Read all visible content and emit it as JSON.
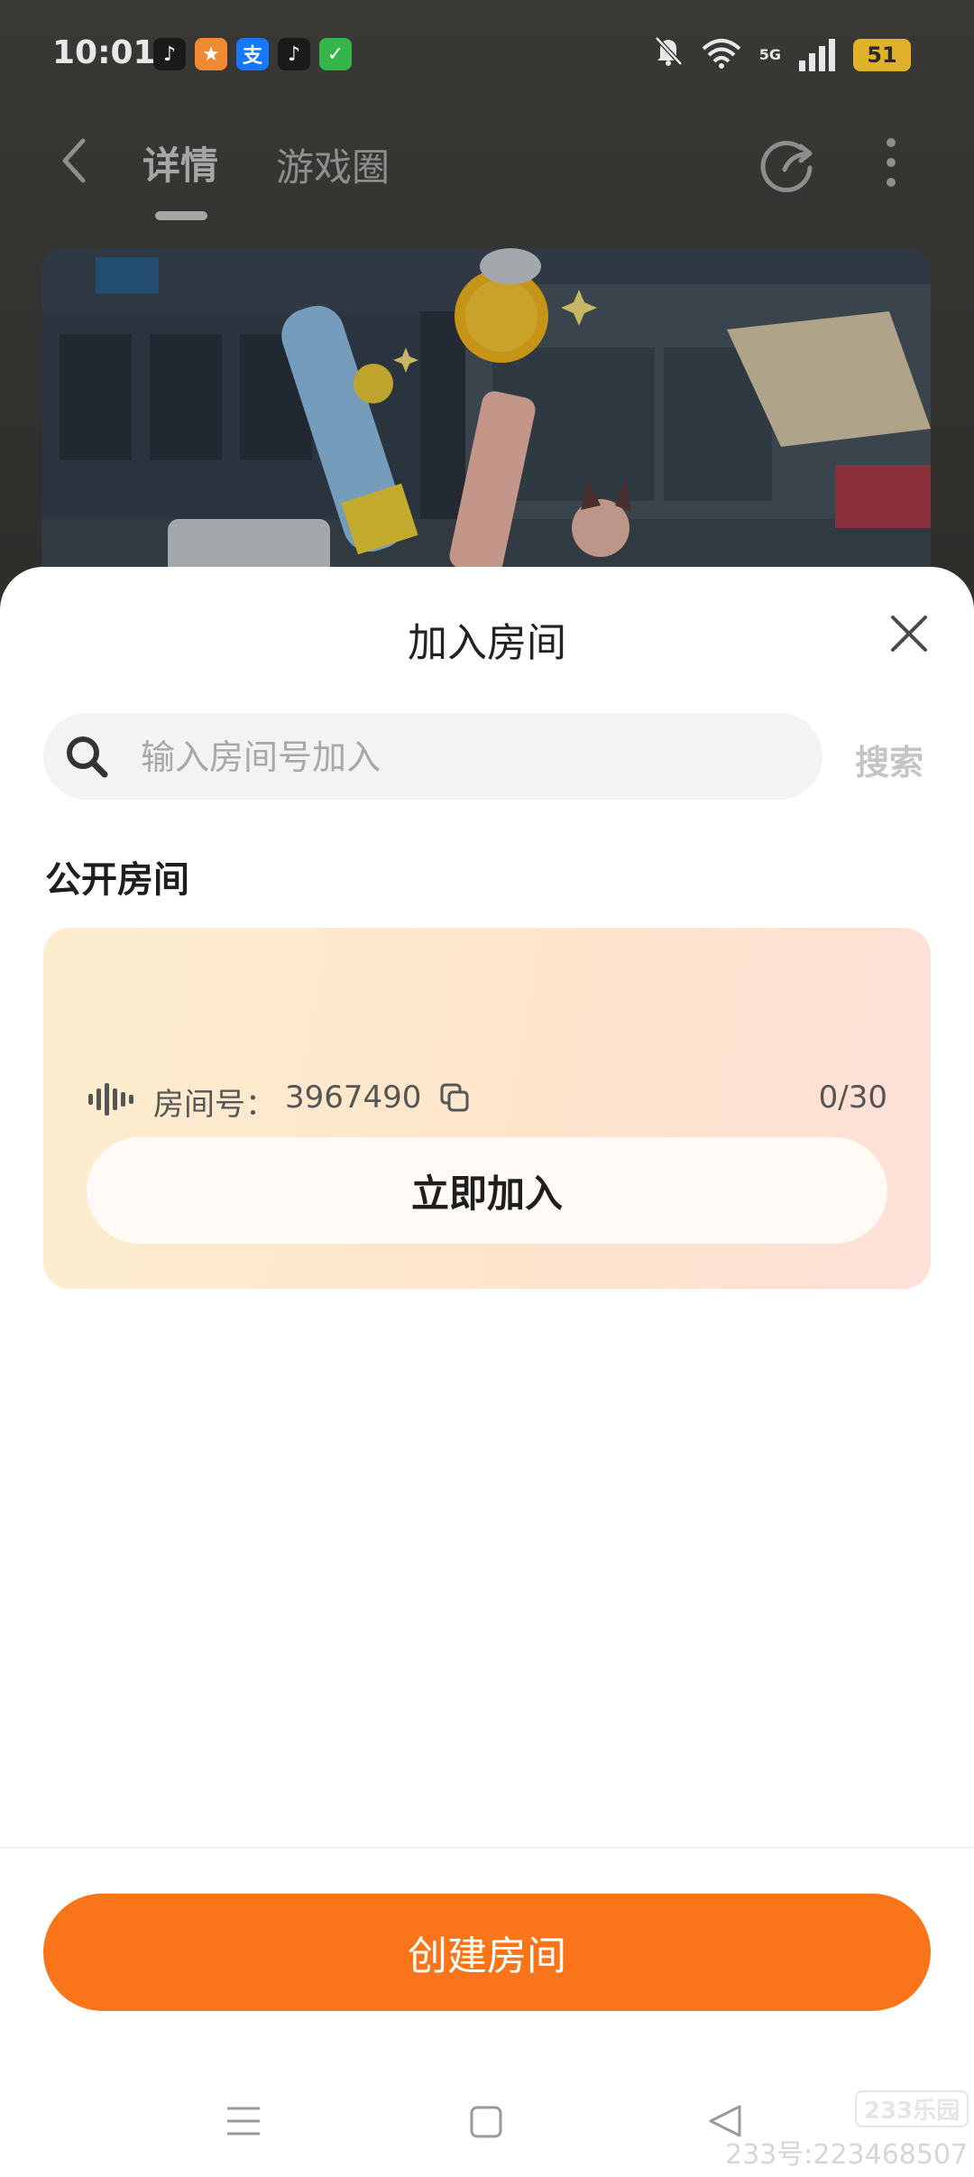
{
  "status_bar": {
    "time": "10:01",
    "network": "5G",
    "battery": "51",
    "apps": [
      {
        "name": "douyin-icon",
        "glyph": "♪",
        "color": "#1a1a1a"
      },
      {
        "name": "game-app-icon",
        "glyph": "★",
        "color": "#f08a32"
      },
      {
        "name": "alipay-icon",
        "glyph": "支",
        "color": "#1677ff"
      },
      {
        "name": "douyin-icon-2",
        "glyph": "♪",
        "color": "#1a1a1a"
      },
      {
        "name": "shield-app-icon",
        "glyph": "✓",
        "color": "#35b54a"
      }
    ]
  },
  "nav": {
    "tab_detail": "详情",
    "tab_circle": "游戏圈"
  },
  "sheet": {
    "title": "加入房间",
    "search": {
      "placeholder": "输入房间号加入",
      "button": "搜索"
    },
    "section_title": "公开房间",
    "room": {
      "label": "房间号：",
      "number": "3967490",
      "count": "0/30",
      "join_label": "立即加入"
    },
    "create_label": "创建房间"
  },
  "watermark": {
    "logo": "233乐园",
    "text": "233号:223468507"
  },
  "colors": {
    "accent": "#fa7519",
    "card_gradient_start": "#fdedcf",
    "card_gradient_end": "#fde0d8"
  }
}
